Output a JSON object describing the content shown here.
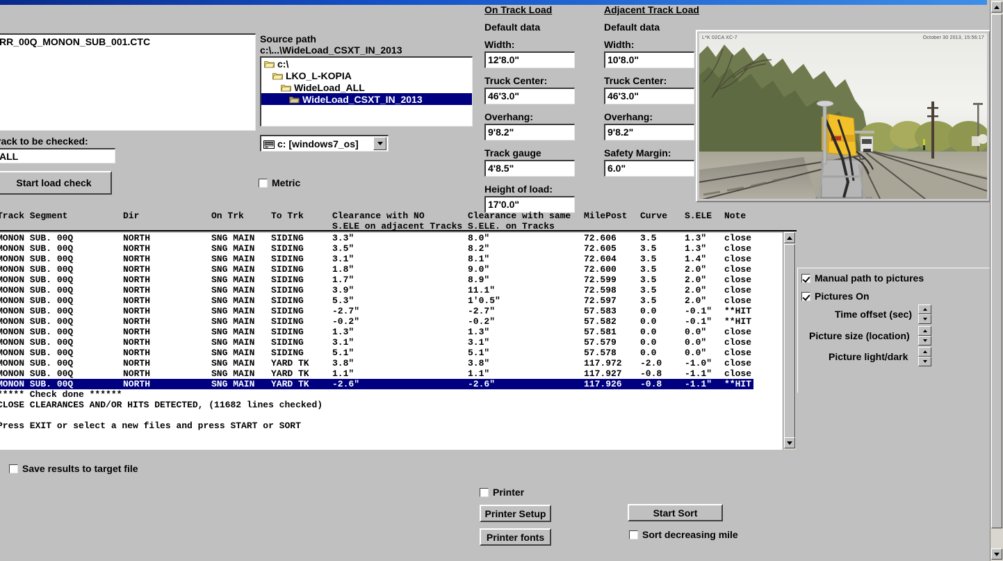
{
  "window": {
    "title_bar_color": "#0a2a8c"
  },
  "file_panel": {
    "selected_file": "RR_00Q_MONON_SUB_001.CTC",
    "track_label": "rack to be checked:",
    "track_value": "ALL",
    "start_button": "Start load check"
  },
  "source_panel": {
    "title": "Source path",
    "path": "c:\\...\\WideLoad_CSXT_IN_2013",
    "folders": [
      {
        "name": "c:\\",
        "indent": 0,
        "selected": false
      },
      {
        "name": "LKO_L-KOPIA",
        "indent": 1,
        "selected": false
      },
      {
        "name": "WideLoad_ALL",
        "indent": 2,
        "selected": false
      },
      {
        "name": "WideLoad_CSXT_IN_2013",
        "indent": 3,
        "selected": true
      }
    ],
    "drive": "c: [windows7_os]",
    "metric_label": "Metric",
    "metric_checked": false
  },
  "on_track_load": {
    "heading": "On Track Load",
    "subheading": "Default data",
    "fields": [
      {
        "label": "Width:",
        "value": "12'8.0\""
      },
      {
        "label": "Truck Center:",
        "value": "46'3.0\""
      },
      {
        "label": "Overhang:",
        "value": "9'8.2\""
      },
      {
        "label": "Track gauge",
        "value": "4'8.5\""
      },
      {
        "label": "Height of load:",
        "value": "17'0.0\""
      }
    ]
  },
  "adjacent_track_load": {
    "heading": "Adjacent Track Load",
    "subheading": "Default data",
    "fields": [
      {
        "label": "Width:",
        "value": "10'8.0\""
      },
      {
        "label": "Truck Center:",
        "value": "46'3.0\""
      },
      {
        "label": "Overhang:",
        "value": "9'8.2\""
      },
      {
        "label": "Safety Margin:",
        "value": "6.0\""
      }
    ]
  },
  "picture": {
    "overlay_left": "L*K 02CA  XC-7",
    "overlay_right": "October 30 2013, 15:56:17"
  },
  "results": {
    "headers": {
      "track_segment": "Track Segment",
      "dir": "Dir",
      "on_trk": "On Trk",
      "to_trk": "To Trk",
      "clearance_no_sele_l1": "Clearance with NO",
      "clearance_no_sele_l2": "S.ELE on adjacent Tracks",
      "clearance_same_sele_l1": "Clearance with same",
      "clearance_same_sele_l2": "S.ELE. on Tracks",
      "milepost": "MilePost",
      "curve": "Curve",
      "sele": "S.ELE",
      "note": "Note"
    },
    "rows": [
      {
        "track": "MONON SUB. 00Q",
        "dir": "NORTH",
        "on": "SNG MAIN",
        "to": "SIDING",
        "cl_no": "3.3\"",
        "cl_same": "8.0\"",
        "mp": "72.606",
        "curve": "3.5",
        "sele": "1.3\"",
        "note": "close",
        "selected": false
      },
      {
        "track": "MONON SUB. 00Q",
        "dir": "NORTH",
        "on": "SNG MAIN",
        "to": "SIDING",
        "cl_no": "3.5\"",
        "cl_same": "8.2\"",
        "mp": "72.605",
        "curve": "3.5",
        "sele": "1.3\"",
        "note": "close",
        "selected": false
      },
      {
        "track": "MONON SUB. 00Q",
        "dir": "NORTH",
        "on": "SNG MAIN",
        "to": "SIDING",
        "cl_no": "3.1\"",
        "cl_same": "8.1\"",
        "mp": "72.604",
        "curve": "3.5",
        "sele": "1.4\"",
        "note": "close",
        "selected": false
      },
      {
        "track": "MONON SUB. 00Q",
        "dir": "NORTH",
        "on": "SNG MAIN",
        "to": "SIDING",
        "cl_no": "1.8\"",
        "cl_same": "9.0\"",
        "mp": "72.600",
        "curve": "3.5",
        "sele": "2.0\"",
        "note": "close",
        "selected": false
      },
      {
        "track": "MONON SUB. 00Q",
        "dir": "NORTH",
        "on": "SNG MAIN",
        "to": "SIDING",
        "cl_no": "1.7\"",
        "cl_same": "8.9\"",
        "mp": "72.599",
        "curve": "3.5",
        "sele": "2.0\"",
        "note": "close",
        "selected": false
      },
      {
        "track": "MONON SUB. 00Q",
        "dir": "NORTH",
        "on": "SNG MAIN",
        "to": "SIDING",
        "cl_no": "3.9\"",
        "cl_same": "11.1\"",
        "mp": "72.598",
        "curve": "3.5",
        "sele": "2.0\"",
        "note": "close",
        "selected": false
      },
      {
        "track": "MONON SUB. 00Q",
        "dir": "NORTH",
        "on": "SNG MAIN",
        "to": "SIDING",
        "cl_no": "5.3\"",
        "cl_same": "1'0.5\"",
        "mp": "72.597",
        "curve": "3.5",
        "sele": "2.0\"",
        "note": "close",
        "selected": false
      },
      {
        "track": "MONON SUB. 00Q",
        "dir": "NORTH",
        "on": "SNG MAIN",
        "to": "SIDING",
        "cl_no": "-2.7\"",
        "cl_same": "-2.7\"",
        "mp": "57.583",
        "curve": "0.0",
        "sele": "-0.1\"",
        "note": "**HIT",
        "selected": false
      },
      {
        "track": "MONON SUB. 00Q",
        "dir": "NORTH",
        "on": "SNG MAIN",
        "to": "SIDING",
        "cl_no": "-0.2\"",
        "cl_same": "-0.2\"",
        "mp": "57.582",
        "curve": "0.0",
        "sele": "-0.1\"",
        "note": "**HIT",
        "selected": false
      },
      {
        "track": "MONON SUB. 00Q",
        "dir": "NORTH",
        "on": "SNG MAIN",
        "to": "SIDING",
        "cl_no": "1.3\"",
        "cl_same": "1.3\"",
        "mp": "57.581",
        "curve": "0.0",
        "sele": "0.0\"",
        "note": "close",
        "selected": false
      },
      {
        "track": "MONON SUB. 00Q",
        "dir": "NORTH",
        "on": "SNG MAIN",
        "to": "SIDING",
        "cl_no": "3.1\"",
        "cl_same": "3.1\"",
        "mp": "57.579",
        "curve": "0.0",
        "sele": "0.0\"",
        "note": "close",
        "selected": false
      },
      {
        "track": "MONON SUB. 00Q",
        "dir": "NORTH",
        "on": "SNG MAIN",
        "to": "SIDING",
        "cl_no": "5.1\"",
        "cl_same": "5.1\"",
        "mp": "57.578",
        "curve": "0.0",
        "sele": "0.0\"",
        "note": "close",
        "selected": false
      },
      {
        "track": "MONON SUB. 00Q",
        "dir": "NORTH",
        "on": "SNG MAIN",
        "to": "YARD TK",
        "cl_no": "3.8\"",
        "cl_same": "3.8\"",
        "mp": "117.972",
        "curve": "-2.0",
        "sele": "-1.0\"",
        "note": "close",
        "selected": false
      },
      {
        "track": "MONON SUB. 00Q",
        "dir": "NORTH",
        "on": "SNG MAIN",
        "to": "YARD TK",
        "cl_no": "1.1\"",
        "cl_same": "1.1\"",
        "mp": "117.927",
        "curve": "-0.8",
        "sele": "-1.1\"",
        "note": "close",
        "selected": false
      },
      {
        "track": "MONON SUB. 00Q",
        "dir": "NORTH",
        "on": "SNG MAIN",
        "to": "YARD TK",
        "cl_no": "-2.6\"",
        "cl_same": "-2.6\"",
        "mp": "117.926",
        "curve": "-0.8",
        "sele": "-1.1\"",
        "note": "**HIT",
        "selected": true
      }
    ],
    "messages": [
      "***** Check done ******",
      "CLOSE CLEARANCES AND/OR HITS DETECTED, (11682 lines checked)",
      "",
      "Press EXIT or select a new files and press START or SORT"
    ]
  },
  "options": {
    "manual_path_label": "Manual path to pictures",
    "manual_path_checked": true,
    "pictures_on_label": "Pictures On",
    "pictures_on_checked": true,
    "time_offset_label": "Time offset (sec)",
    "picture_size_label": "Picture size (location)",
    "picture_light_label": "Picture light/dark"
  },
  "footer": {
    "save_results_label": "Save results to target file",
    "save_results_checked": false,
    "printer_label": "Printer",
    "printer_checked": false,
    "printer_setup_button": "Printer Setup",
    "printer_fonts_button": "Printer fonts",
    "start_sort_button": "Start Sort",
    "sort_decreasing_label": "Sort decreasing mile",
    "sort_decreasing_checked": false
  }
}
